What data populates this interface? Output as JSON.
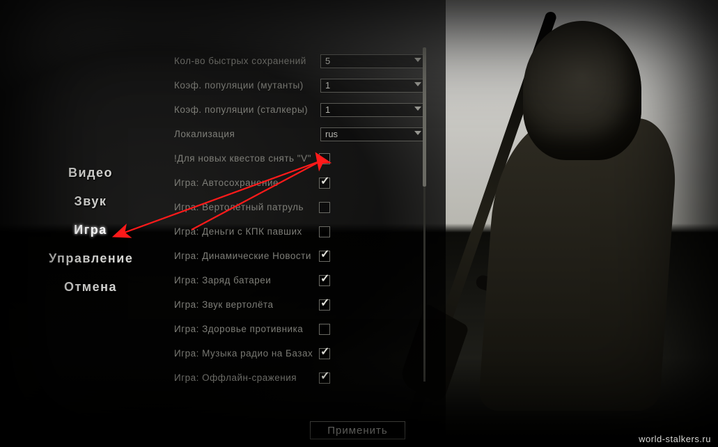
{
  "tabs": {
    "video": "Видео",
    "sound": "Звук",
    "game": "Игра",
    "controls": "Управление",
    "cancel": "Отмена",
    "active": "game"
  },
  "settings": {
    "dropdowns": [
      {
        "id": "quicksaves",
        "label": "Кол-во быстрых сохранений",
        "value": "5"
      },
      {
        "id": "pop_mutants",
        "label": "Коэф. популяции (мутанты)",
        "value": "1"
      },
      {
        "id": "pop_stalkers",
        "label": "Коэф. популяции (сталкеры)",
        "value": "1"
      },
      {
        "id": "localization",
        "label": "Локализация",
        "value": "rus"
      }
    ],
    "checkboxes": [
      {
        "id": "new_quests_clear",
        "label": "!Для новых квестов снять \"V\"",
        "checked": false
      },
      {
        "id": "autosave",
        "label": "Игра: Автосохранение",
        "checked": true
      },
      {
        "id": "heli_patrol",
        "label": "Игра: Вертолётный патруль",
        "checked": false
      },
      {
        "id": "money_pda",
        "label": "Игра: Деньги с КПК павших",
        "checked": false
      },
      {
        "id": "dyn_news",
        "label": "Игра: Динамические Новости",
        "checked": true
      },
      {
        "id": "battery_charge",
        "label": "Игра: Заряд батареи",
        "checked": true
      },
      {
        "id": "heli_sound",
        "label": "Игра: Звук вертолёта",
        "checked": true
      },
      {
        "id": "enemy_health",
        "label": "Игра: Здоровье противника",
        "checked": false
      },
      {
        "id": "base_radio_music",
        "label": "Игра: Музыка радио на Базах",
        "checked": true
      },
      {
        "id": "offline_fights",
        "label": "Игра: Оффлайн-сражения",
        "checked": true
      }
    ]
  },
  "buttons": {
    "apply": "Применить"
  },
  "watermark": "world-stalkers.ru"
}
